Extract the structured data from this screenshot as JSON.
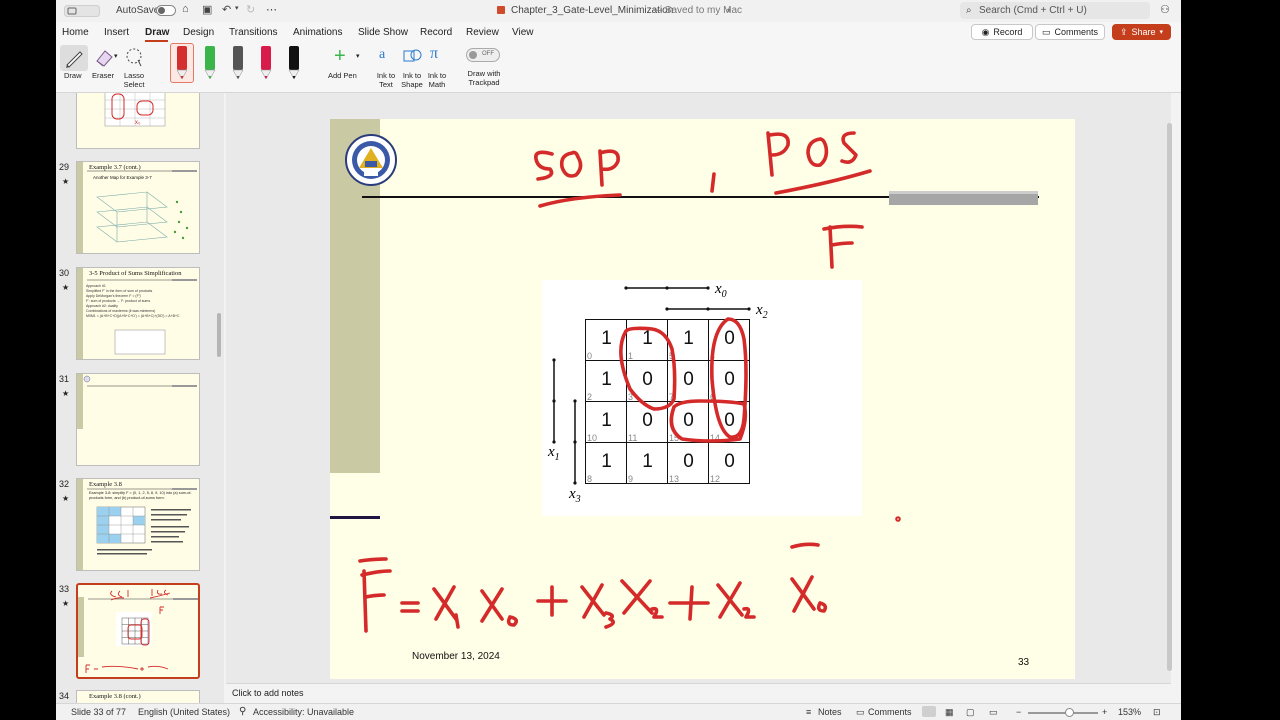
{
  "titlebar": {
    "autosave_label": "AutoSave",
    "doc_title": "Chapter_3_Gate-Level_Minimization",
    "save_status": "— Saved to my Mac",
    "search_placeholder": "Search (Cmd + Ctrl + U)"
  },
  "ribbon": {
    "tabs": [
      "Home",
      "Insert",
      "Draw",
      "Design",
      "Transitions",
      "Animations",
      "Slide Show",
      "Record",
      "Review",
      "View"
    ],
    "active_tab": "Draw",
    "buttons": {
      "record": "Record",
      "comments": "Comments",
      "share": "Share"
    },
    "tools": {
      "draw": "Draw",
      "eraser": "Eraser",
      "lasso": "Lasso Select",
      "add_pen": "Add Pen",
      "ink_text": "Ink to Text",
      "ink_shape": "Ink to Shape",
      "ink_math": "Ink to Math",
      "toggle": "OFF",
      "draw_trackpad": "Draw with Trackpad"
    },
    "pen_colors": [
      "#d32f2f",
      "#3ab54a",
      "#555555",
      "#d81b4a",
      "#111111"
    ]
  },
  "thumbnails": [
    {
      "num": "29",
      "title": "Example 3.7 (cont.)",
      "subtitle": "Another Map for Example 3-7"
    },
    {
      "num": "30",
      "title": "3-5  Product of Sums Simplification",
      "lines": [
        "Approach #1",
        "Simplified F' in the form of sum of products",
        "Apply DeMorgan's theorem F = (F')'",
        "F': sum of products → F: product of sums",
        "Approach #2: duality",
        "Combinations of maxterms (it was minterms)",
        "M0M1 = (A+B+C+D)(A+B+C+D') = (A+B+C)+(DD') = A+B+C"
      ]
    },
    {
      "num": "31"
    },
    {
      "num": "32",
      "title": "Example 3.8",
      "subtitle": "Example 3-8: simplify F = (0, 1, 2, 5, 8, 9, 10) into (a) sum-of-products form, and (b) product-of-sums form:"
    },
    {
      "num": "33"
    },
    {
      "num": "34",
      "title": "Example 3.8 (cont.)"
    }
  ],
  "slide": {
    "date": "November 13, 2024",
    "page_number": "33",
    "kmap": {
      "label_x0": "x0",
      "label_x2": "x2",
      "label_x1": "x1",
      "label_x3": "x3",
      "values": [
        [
          "1",
          "1",
          "1",
          "0"
        ],
        [
          "1",
          "0",
          "0",
          "0"
        ],
        [
          "1",
          "0",
          "0",
          "0"
        ],
        [
          "1",
          "1",
          "0",
          "0"
        ]
      ],
      "indices": [
        [
          "0",
          "1",
          "5",
          "4"
        ],
        [
          "2",
          "3",
          "7",
          "6"
        ],
        [
          "10",
          "11",
          "15",
          "14"
        ],
        [
          "8",
          "9",
          "13",
          "12"
        ]
      ]
    },
    "ink_color": "#d42a2a"
  },
  "notes_placeholder": "Click to add notes",
  "status": {
    "slide_info": "Slide 33 of 77",
    "language": "English (United States)",
    "accessibility": "Accessibility: Unavailable",
    "notes": "Notes",
    "comments": "Comments",
    "zoom": "153%"
  }
}
